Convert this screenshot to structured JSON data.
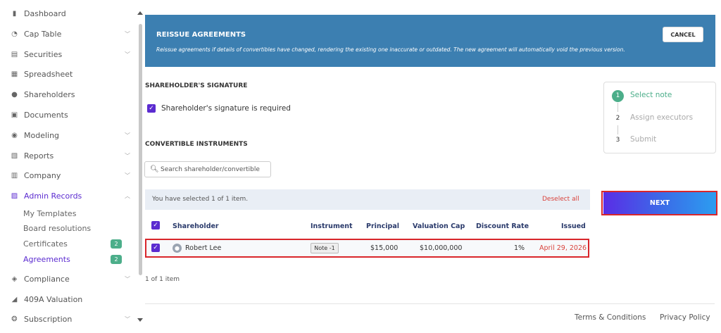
{
  "sidebar": {
    "items": [
      {
        "label": "Dashboard",
        "icon": "dashboard-icon",
        "glyph": "▮▮",
        "chevron": false
      },
      {
        "label": "Cap Table",
        "icon": "pie-chart-icon",
        "glyph": "◔",
        "chevron": true
      },
      {
        "label": "Securities",
        "icon": "clipboard-icon",
        "glyph": "▤",
        "chevron": true
      },
      {
        "label": "Spreadsheet",
        "icon": "spreadsheet-icon",
        "glyph": "▦",
        "chevron": false
      },
      {
        "label": "Shareholders",
        "icon": "person-icon",
        "glyph": "●",
        "chevron": false
      },
      {
        "label": "Documents",
        "icon": "folder-icon",
        "glyph": "▣",
        "chevron": false
      },
      {
        "label": "Modeling",
        "icon": "lightbulb-icon",
        "glyph": "◉",
        "chevron": true
      },
      {
        "label": "Reports",
        "icon": "report-icon",
        "glyph": "▧",
        "chevron": true
      },
      {
        "label": "Company",
        "icon": "building-icon",
        "glyph": "▥",
        "chevron": true
      },
      {
        "label": "Admin Records",
        "icon": "records-icon",
        "glyph": "▨",
        "chevron": true
      },
      {
        "label": "Compliance",
        "icon": "shield-icon",
        "glyph": "◈",
        "chevron": true
      },
      {
        "label": "409A Valuation",
        "icon": "valuation-icon",
        "glyph": "◢",
        "chevron": false
      },
      {
        "label": "Subscription",
        "icon": "subscription-icon",
        "glyph": "❂",
        "chevron": true
      }
    ],
    "sub_items": [
      {
        "label": "My Templates"
      },
      {
        "label": "Board resolutions"
      },
      {
        "label": "Certificates",
        "badge": "2"
      },
      {
        "label": "Agreements",
        "badge": "2"
      }
    ]
  },
  "banner": {
    "title": "REISSUE AGREEMENTS",
    "description": "Reissue agreements if details of convertibles have changed, rendering the existing one inaccurate or outdated. The new agreement will automatically void the previous version.",
    "cancel_label": "CANCEL"
  },
  "signature": {
    "section_title": "SHAREHOLDER'S SIGNATURE",
    "checkbox_label": "Shareholder's signature is required"
  },
  "instruments": {
    "section_title": "CONVERTIBLE INSTRUMENTS",
    "search_placeholder": "Search shareholder/convertible",
    "selection_text": "You have selected 1 of 1 item.",
    "deselect_label": "Deselect all",
    "columns": {
      "shareholder": "Shareholder",
      "instrument": "Instrument",
      "principal": "Principal",
      "valuation_cap": "Valuation Cap",
      "discount_rate": "Discount Rate",
      "issued": "Issued"
    },
    "row": {
      "shareholder": "Robert Lee",
      "instrument": "Note -1",
      "principal": "$15,000",
      "valuation_cap": "$10,000,000",
      "discount_rate": "1%",
      "issued": "April 29, 2026"
    },
    "pager_text": "1 of 1 item"
  },
  "steps": [
    {
      "number": "1",
      "label": "Select note"
    },
    {
      "number": "2",
      "label": "Assign executors"
    },
    {
      "number": "3",
      "label": "Submit"
    }
  ],
  "next_label": "NEXT",
  "footer": {
    "terms": "Terms & Conditions",
    "privacy": "Privacy Policy"
  },
  "colors": {
    "banner": "#3c7fb1",
    "accent": "#5b2bd0",
    "step_active": "#4cae8a",
    "danger": "#d9423b"
  }
}
